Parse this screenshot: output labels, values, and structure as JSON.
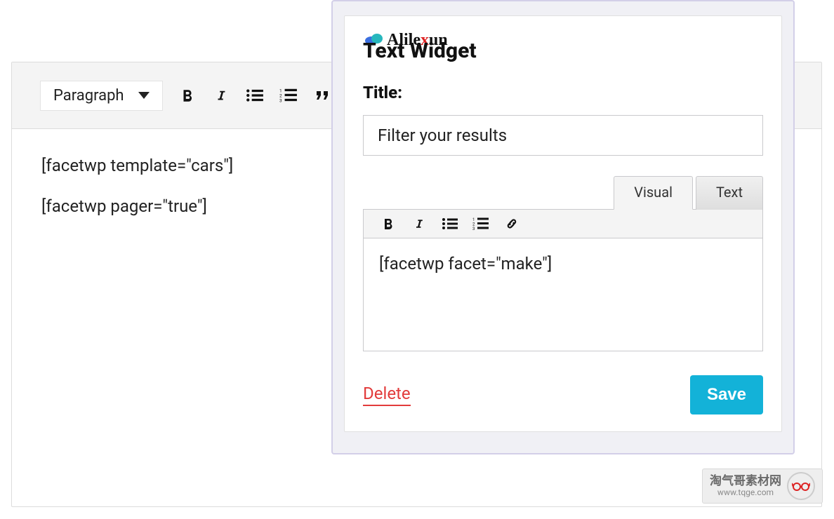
{
  "editor": {
    "format_selector": "Paragraph",
    "body_lines": [
      "[facetwp template=\"cars\"]",
      "[facetwp pager=\"true\"]"
    ]
  },
  "widget": {
    "logo_text": "Alilexun",
    "header": "Text Widget",
    "title_label": "Title:",
    "title_value": "Filter your results",
    "tabs": {
      "visual": "Visual",
      "text": "Text"
    },
    "content": "[facetwp facet=\"make\"]",
    "delete_label": "Delete",
    "save_label": "Save"
  },
  "watermark": {
    "cn": "淘气哥素材网",
    "url": "www.tqge.com"
  }
}
